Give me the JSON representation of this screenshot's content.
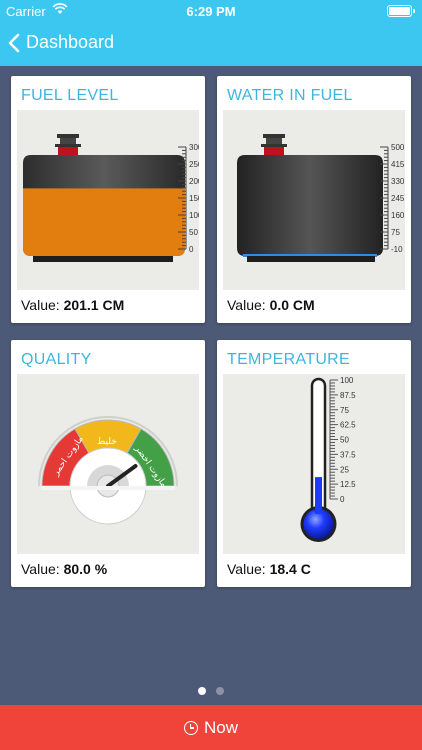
{
  "status_bar": {
    "carrier": "Carrier",
    "time": "6:29 PM"
  },
  "nav": {
    "back_label": "Dashboard"
  },
  "cards": {
    "fuel": {
      "title": "FUEL LEVEL",
      "value_label": "Value:",
      "value": "201.1 CM",
      "scale": [
        "300",
        "250",
        "200",
        "150",
        "100",
        "50",
        "0"
      ],
      "fill_fraction": 0.67,
      "fill_color": "#e27d10"
    },
    "water": {
      "title": "WATER IN FUEL",
      "value_label": "Value:",
      "value": "0.0 CM",
      "scale": [
        "500",
        "415",
        "330",
        "245",
        "160",
        "75",
        "-10"
      ],
      "fill_fraction": 0.0,
      "fill_color": "#2d8de4"
    },
    "quality": {
      "title": "QUALITY",
      "value_label": "Value:",
      "value": "80.0 %",
      "gauge_labels": [
        "مازوت احمر",
        "خليط",
        "مازوت اخضر"
      ],
      "gauge_colors": [
        "#e53935",
        "#f2b71a",
        "#43a047"
      ],
      "needle_fraction": 0.8
    },
    "temperature": {
      "title": "TEMPERATURE",
      "value_label": "Value:",
      "value": "18.4 C",
      "scale": [
        "100",
        "87.5",
        "75",
        "62.5",
        "50",
        "37.5",
        "25",
        "12.5",
        "0"
      ],
      "level_fraction": 0.184,
      "mercury_color": "#1a3cff"
    }
  },
  "pager": {
    "pages": 2,
    "active": 0
  },
  "footer": {
    "now_label": "Now",
    "now_icon": "clock-icon",
    "accent": "#f0433a"
  },
  "colors": {
    "header": "#3cc7f0",
    "background": "#4d5a77",
    "title": "#3cb6e0"
  }
}
